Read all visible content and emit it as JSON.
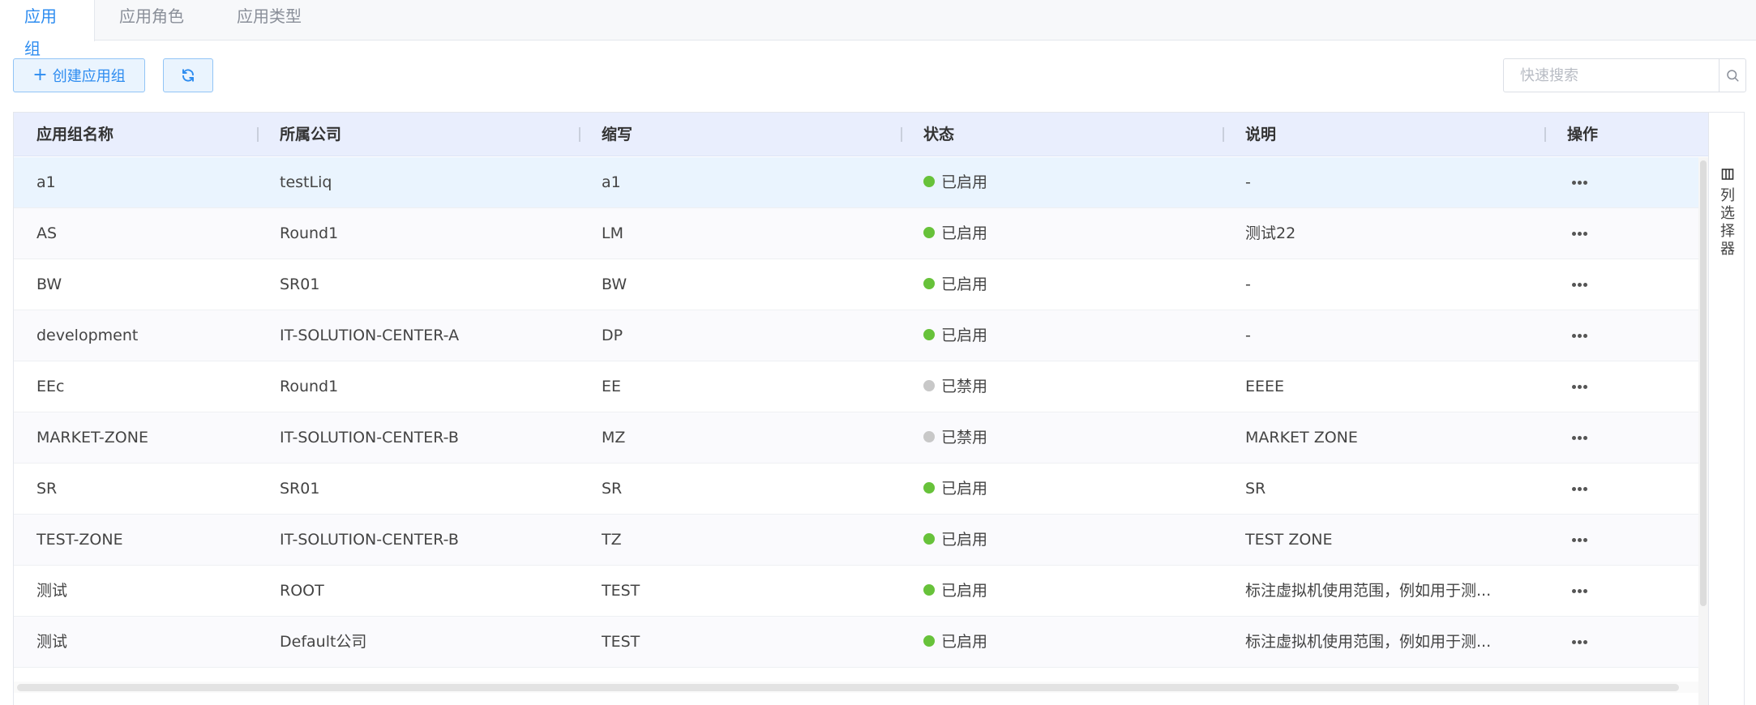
{
  "tabs": [
    {
      "label": "应用组",
      "active": true
    },
    {
      "label": "应用角色",
      "active": false
    },
    {
      "label": "应用类型",
      "active": false
    }
  ],
  "toolbar": {
    "create_label": "创建应用组",
    "search_placeholder": "快速搜索"
  },
  "table": {
    "columns": [
      "应用组名称",
      "所属公司",
      "缩写",
      "状态",
      "说明",
      "操作"
    ],
    "rows": [
      {
        "name": "a1",
        "company": "testLiq",
        "abbr": "a1",
        "status": "已启用",
        "enabled": true,
        "desc": "-"
      },
      {
        "name": "AS",
        "company": "Round1",
        "abbr": "LM",
        "status": "已启用",
        "enabled": true,
        "desc": "测试22"
      },
      {
        "name": "BW",
        "company": "SR01",
        "abbr": "BW",
        "status": "已启用",
        "enabled": true,
        "desc": "-"
      },
      {
        "name": "development",
        "company": "IT-SOLUTION-CENTER-A",
        "abbr": "DP",
        "status": "已启用",
        "enabled": true,
        "desc": "-"
      },
      {
        "name": "EEc",
        "company": "Round1",
        "abbr": "EE",
        "status": "已禁用",
        "enabled": false,
        "desc": "EEEE"
      },
      {
        "name": "MARKET-ZONE",
        "company": "IT-SOLUTION-CENTER-B",
        "abbr": "MZ",
        "status": "已禁用",
        "enabled": false,
        "desc": "MARKET ZONE"
      },
      {
        "name": "SR",
        "company": "SR01",
        "abbr": "SR",
        "status": "已启用",
        "enabled": true,
        "desc": "SR"
      },
      {
        "name": "TEST-ZONE",
        "company": "IT-SOLUTION-CENTER-B",
        "abbr": "TZ",
        "status": "已启用",
        "enabled": true,
        "desc": "TEST ZONE"
      },
      {
        "name": "测试",
        "company": "ROOT",
        "abbr": "TEST",
        "status": "已启用",
        "enabled": true,
        "desc": "标注虚拟机使用范围，例如用于测..."
      },
      {
        "name": "测试",
        "company": "Default公司",
        "abbr": "TEST",
        "status": "已启用",
        "enabled": true,
        "desc": "标注虚拟机使用范围，例如用于测..."
      }
    ]
  },
  "column_selector": {
    "label": "列选择器"
  },
  "colors": {
    "accent": "#2d8cf0",
    "enabled": "#67c23a",
    "disabled": "#c8c8c8"
  },
  "icons": {
    "create": "plus-icon",
    "refresh": "refresh-icon",
    "search": "search-icon",
    "row_action": "more-icon",
    "column_selector": "columns-icon"
  }
}
